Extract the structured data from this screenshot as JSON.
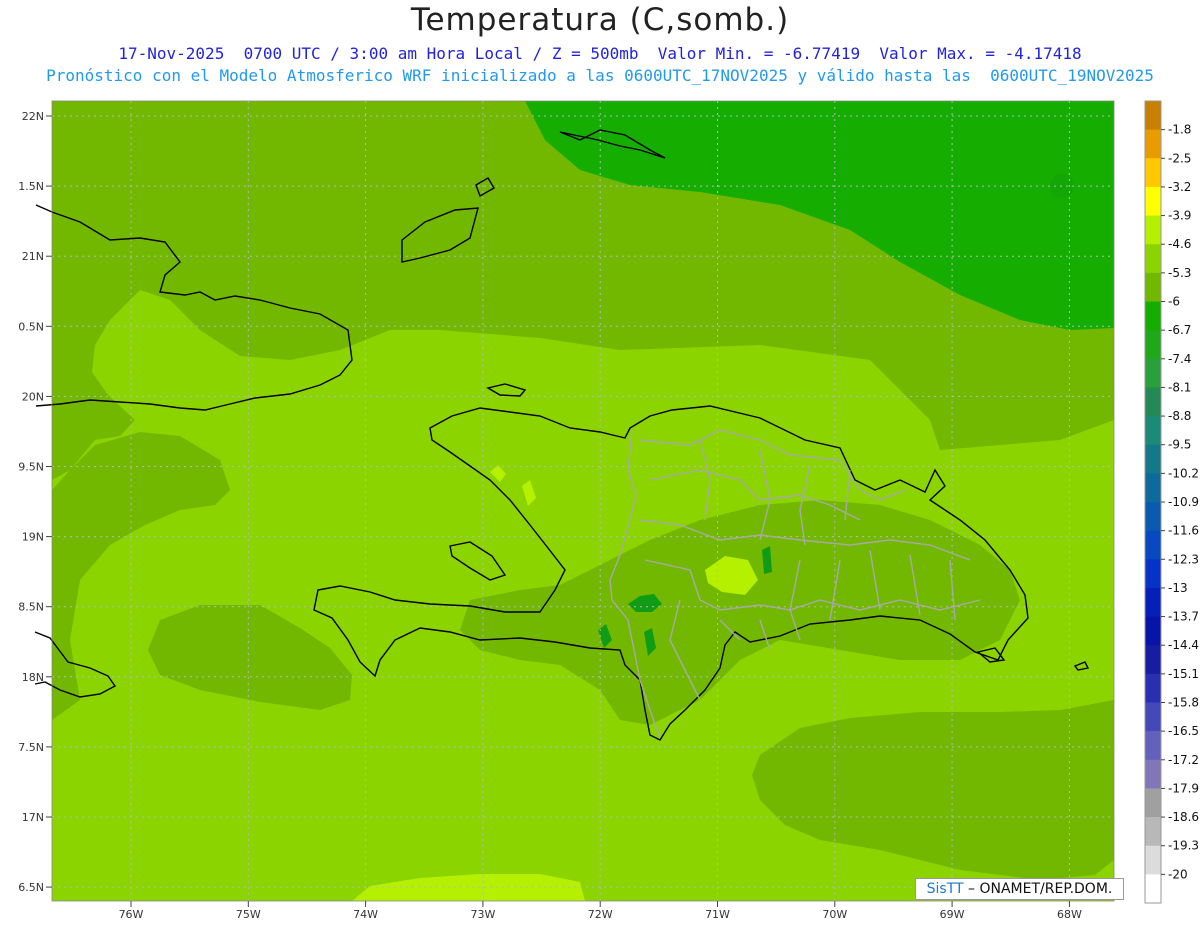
{
  "header": {
    "title": "Temperatura (C,somb.)",
    "subtitle_line1": "17-Nov-2025  0700 UTC / 3:00 am Hora Local / Z = 500mb  Valor Min. = -6.77419  Valor Max. = -4.17418",
    "subtitle_line2": "Pronóstico con el Modelo Atmosferico WRF inicializado a las 0600UTC_17NOV2025 y válido hasta las  0600UTC_19NOV2025"
  },
  "map": {
    "lat_labels": [
      "22N",
      "1.5N",
      "21N",
      "0.5N",
      "20N",
      "9.5N",
      "19N",
      "8.5N",
      "18N",
      "7.5N",
      "17N",
      "6.5N"
    ],
    "lon_labels": [
      "76W",
      "75W",
      "74W",
      "73W",
      "72W",
      "71W",
      "70W",
      "69W",
      "68W"
    ],
    "fill_colors": {
      "level_neg4_6": "#8cd400",
      "level_neg5_3": "#73b800",
      "level_neg6": "#14ad00",
      "level_neg3_9": "#b4f000",
      "level_neg6_7": "#109c14"
    },
    "coastline_color": "#000000",
    "border_color": "#a8a8a8"
  },
  "colorbar": {
    "labels": [
      "-1.8",
      "-2.5",
      "-3.2",
      "-3.9",
      "-4.6",
      "-5.3",
      "-6",
      "-6.7",
      "-7.4",
      "-8.1",
      "-8.8",
      "-9.5",
      "-10.2",
      "-10.9",
      "-11.6",
      "-12.3",
      "-13",
      "-13.7",
      "-14.4",
      "-15.1",
      "-15.8",
      "-16.5",
      "-17.2",
      "-17.9",
      "-18.6",
      "-19.3",
      "-20"
    ],
    "colors": [
      "#c88000",
      "#e89c00",
      "#ffc800",
      "#ffff00",
      "#b4f000",
      "#8cd400",
      "#73b800",
      "#14ad00",
      "#20a818",
      "#2aa03a",
      "#238a55",
      "#1b8a76",
      "#147888",
      "#0d6a9a",
      "#0a5ab0",
      "#0848c0",
      "#0632c8",
      "#0420b8",
      "#0814a8",
      "#181ca0",
      "#2a2eb0",
      "#4548b8",
      "#6262bc",
      "#8275b8",
      "#a0a0a0",
      "#b8b8b8",
      "#dcdcdc",
      "#ffffff"
    ]
  },
  "credit": {
    "brand": "SisTT",
    "text": "– ONAMET/REP.DOM."
  }
}
